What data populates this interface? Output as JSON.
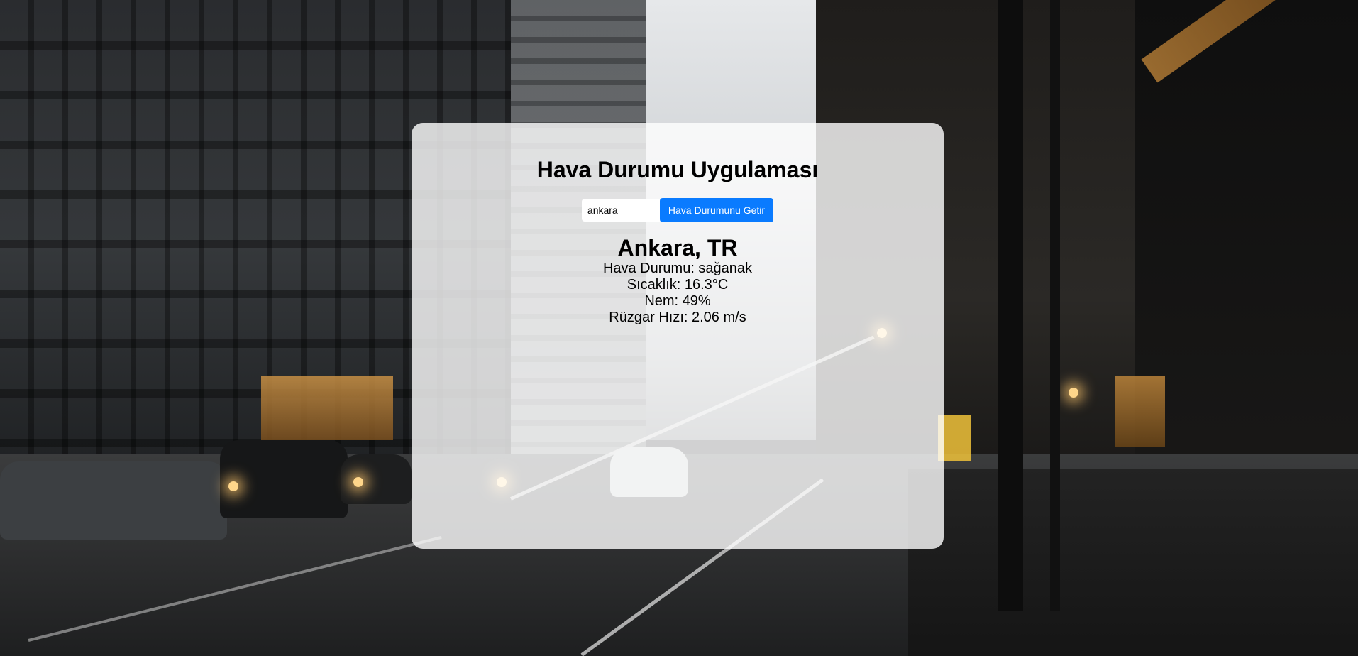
{
  "app": {
    "title": "Hava Durumu Uygulaması"
  },
  "search": {
    "value": "ankara",
    "button_label": "Hava Durumunu Getir"
  },
  "weather": {
    "location": "Ankara, TR",
    "condition": "Hava Durumu: sağanak",
    "temperature": "Sıcaklık: 16.3°C",
    "humidity": "Nem: 49%",
    "wind": "Rüzgar Hızı: 2.06 m/s"
  }
}
